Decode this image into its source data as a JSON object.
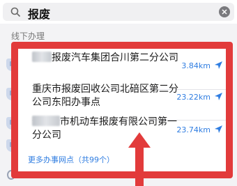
{
  "search": {
    "query": "报废"
  },
  "section": {
    "title": "线下办理"
  },
  "results": [
    {
      "name_prefix_hidden": true,
      "name": "报废汽车集团合川第二分公司",
      "distance": "3.84km"
    },
    {
      "name": "重庆市报废回收公司北碚区第二分公司东阳办事点",
      "distance": "23.22km"
    },
    {
      "name_prefix_hidden": true,
      "name": "市机动车报废有限公司第一分公司",
      "distance": "23.74km"
    }
  ],
  "more": {
    "label": "更多办事网点（共99个）"
  },
  "colors": {
    "accent": "#2f7de1",
    "highlight": "#e23b3b"
  }
}
